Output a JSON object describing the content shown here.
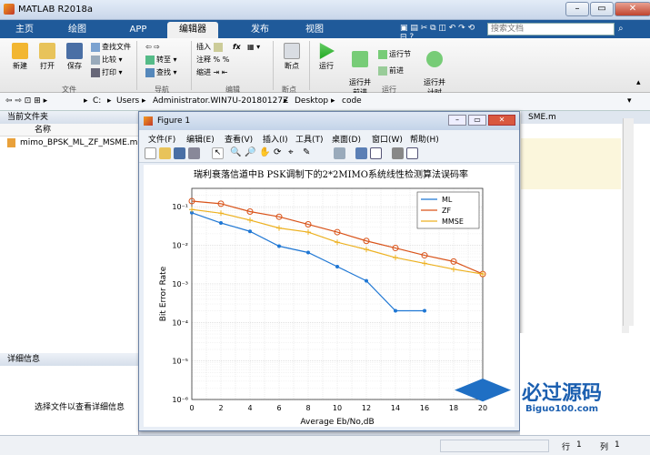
{
  "window": {
    "title": "MATLAB R2018a",
    "min": "–",
    "max": "▭",
    "close": "✕"
  },
  "tabs": [
    "主页",
    "绘图",
    "APP",
    "编辑器",
    "发布",
    "视图"
  ],
  "search_placeholder": "搜索文档",
  "ribbon": {
    "file_group": {
      "new": "新建",
      "open": "打开",
      "save": "保存",
      "find_files": "查找文件",
      "compare": "比较",
      "print": "打印",
      "label": "文件"
    },
    "nav_group": {
      "goto": "转至",
      "find": "查找",
      "label": "导航"
    },
    "edit_group": {
      "insert": "插入",
      "comment": "注释",
      "indent": "缩进",
      "fx": "fx",
      "label": "编辑"
    },
    "bp_group": {
      "breakpoint": "断点",
      "label": "断点"
    },
    "run_group": {
      "run": "运行",
      "run_advance": "运行并\n前进",
      "run_section": "运行节",
      "advance": "前进",
      "run_time": "运行并\n计时",
      "label": "运行"
    }
  },
  "address": {
    "path": [
      "C:",
      "Users",
      "Administrator.WIN7U-20180127Z",
      "Desktop",
      "code"
    ]
  },
  "current_folder": {
    "header": "当前文件夹",
    "col_name": "名称",
    "files": [
      "mimo_BPSK_ML_ZF_MSME.m"
    ]
  },
  "details": {
    "header": "详细信息",
    "placeholder": "选择文件以查看详细信息"
  },
  "editor": {
    "tab_fragment": "SME.m"
  },
  "figure": {
    "title": "Figure 1",
    "menus": [
      "文件(F)",
      "编辑(E)",
      "查看(V)",
      "插入(I)",
      "工具(T)",
      "桌面(D)",
      "窗口(W)",
      "帮助(H)"
    ]
  },
  "chart_data": {
    "type": "line",
    "title": "瑞利衰落信道中B PSK调制下的2*2MIMO系统线性检测算法误码率",
    "xlabel": "Average Eb/No,dB",
    "ylabel": "Bit Error Rate",
    "xlim": [
      0,
      20
    ],
    "ylim": [
      1e-06,
      0.3
    ],
    "yscale": "log",
    "grid": true,
    "legend": "top-right",
    "x_ticks": [
      "0",
      "2",
      "4",
      "6",
      "8",
      "10",
      "12",
      "14",
      "16",
      "18",
      "20"
    ],
    "y_ticks": [
      "10⁻⁶",
      "10⁻⁵",
      "10⁻⁴",
      "10⁻³",
      "10⁻²",
      "10⁻¹"
    ],
    "series": [
      {
        "name": "ML",
        "color": "#1f77d4",
        "marker": "dot",
        "x": [
          0,
          2,
          4,
          6,
          8,
          10,
          12,
          14,
          16
        ],
        "y": [
          0.07,
          0.038,
          0.023,
          0.0095,
          0.0065,
          0.0028,
          0.0012,
          0.0002,
          0.0002
        ]
      },
      {
        "name": "ZF",
        "color": "#d95319",
        "marker": "circle",
        "x": [
          0,
          2,
          4,
          6,
          8,
          10,
          12,
          14,
          16,
          18,
          20
        ],
        "y": [
          0.14,
          0.12,
          0.075,
          0.055,
          0.035,
          0.022,
          0.013,
          0.0085,
          0.0055,
          0.0038,
          0.0018
        ]
      },
      {
        "name": "MMSE",
        "color": "#edb120",
        "marker": "plus",
        "x": [
          0,
          2,
          4,
          6,
          8,
          10,
          12,
          14,
          16,
          18,
          20
        ],
        "y": [
          0.085,
          0.068,
          0.045,
          0.028,
          0.022,
          0.012,
          0.0078,
          0.0048,
          0.0034,
          0.0024,
          0.0018
        ]
      }
    ]
  },
  "status": {
    "row_label": "行",
    "row_value": "1",
    "col_label": "列",
    "col_value": "1"
  },
  "watermark": {
    "brand": "必过源码",
    "url": "Biguo100.com"
  }
}
